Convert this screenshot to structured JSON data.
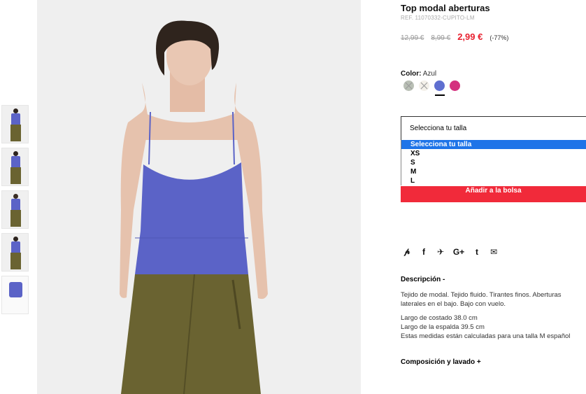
{
  "product": {
    "title": "Top modal aberturas",
    "ref": "REF. 11070332-CUPITO-LM",
    "price_original": "12,99 €",
    "price_previous": "8,99 €",
    "price_current": "2,99 €",
    "discount": "(-77%)"
  },
  "color": {
    "label": "Color:",
    "selected": "Azul",
    "swatches": [
      {
        "name": "gris",
        "hex": "#b9bfb5",
        "available": false
      },
      {
        "name": "blanco",
        "hex": "#f4f1ea",
        "available": false
      },
      {
        "name": "azul",
        "hex": "#5f6fd0",
        "available": true
      },
      {
        "name": "rosa",
        "hex": "#d4317f",
        "available": true
      }
    ]
  },
  "size": {
    "placeholder": "Selecciona tu talla",
    "options": [
      "Selecciona tu talla",
      "XS",
      "S",
      "M",
      "L"
    ]
  },
  "add_to_bag": "Añadir a la bolsa",
  "share_icons": [
    "pinterest-icon",
    "facebook-icon",
    "twitter-icon",
    "google-plus-icon",
    "tumblr-icon",
    "email-icon"
  ],
  "share_glyphs": [
    "℗",
    "f",
    "✧",
    "G+",
    "t",
    "✉"
  ],
  "description": {
    "heading": "Descripción -",
    "line1": "Tejido de modal. Tejido fluido. Tirantes finos. Aberturas",
    "line2": "laterales en el bajo. Bajo con vuelo.",
    "measure1": "Largo de costado 38.0 cm",
    "measure2": "Largo de la espalda 39.5 cm",
    "measure3": "Estas medidas están calculadas para una talla M español"
  },
  "composition_heading": "Composición y lavado +",
  "colors": {
    "accent": "#e8202f",
    "button": "#f12a3a",
    "select_highlight": "#1e74e8",
    "top_blue": "#5b63c7",
    "skirt_olive": "#6a6331"
  }
}
